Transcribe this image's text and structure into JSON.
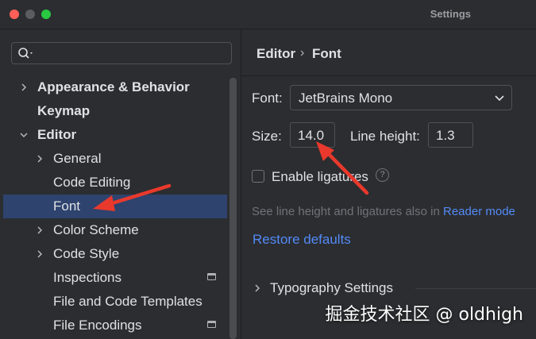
{
  "window": {
    "title": "Settings"
  },
  "search": {
    "placeholder": "",
    "value": ""
  },
  "sidebar": {
    "items": [
      {
        "label": "Appearance & Behavior"
      },
      {
        "label": "Keymap"
      },
      {
        "label": "Editor"
      },
      {
        "label": "General"
      },
      {
        "label": "Code Editing"
      },
      {
        "label": "Font"
      },
      {
        "label": "Color Scheme"
      },
      {
        "label": "Code Style"
      },
      {
        "label": "Inspections"
      },
      {
        "label": "File and Code Templates"
      },
      {
        "label": "File Encodings"
      }
    ]
  },
  "breadcrumb": {
    "parent": "Editor",
    "separator": "›",
    "current": "Font"
  },
  "font_settings": {
    "font_label": "Font:",
    "font_value": "JetBrains Mono",
    "size_label": "Size:",
    "size_value": "14.0",
    "line_height_label": "Line height:",
    "line_height_value": "1.3",
    "ligatures_label": "Enable ligatures",
    "ligatures_checked": false,
    "help_glyph": "?",
    "hint_prefix": "See line height and ligatures also in ",
    "hint_link": "Reader mode",
    "restore_label": "Restore defaults",
    "typography_label": "Typography Settings"
  },
  "watermark": "掘金技术社区 @ oldhigh",
  "colors": {
    "background": "#2b2d30",
    "selection": "#2e436e",
    "link": "#548af7",
    "annotation_arrow": "#e8392c"
  }
}
